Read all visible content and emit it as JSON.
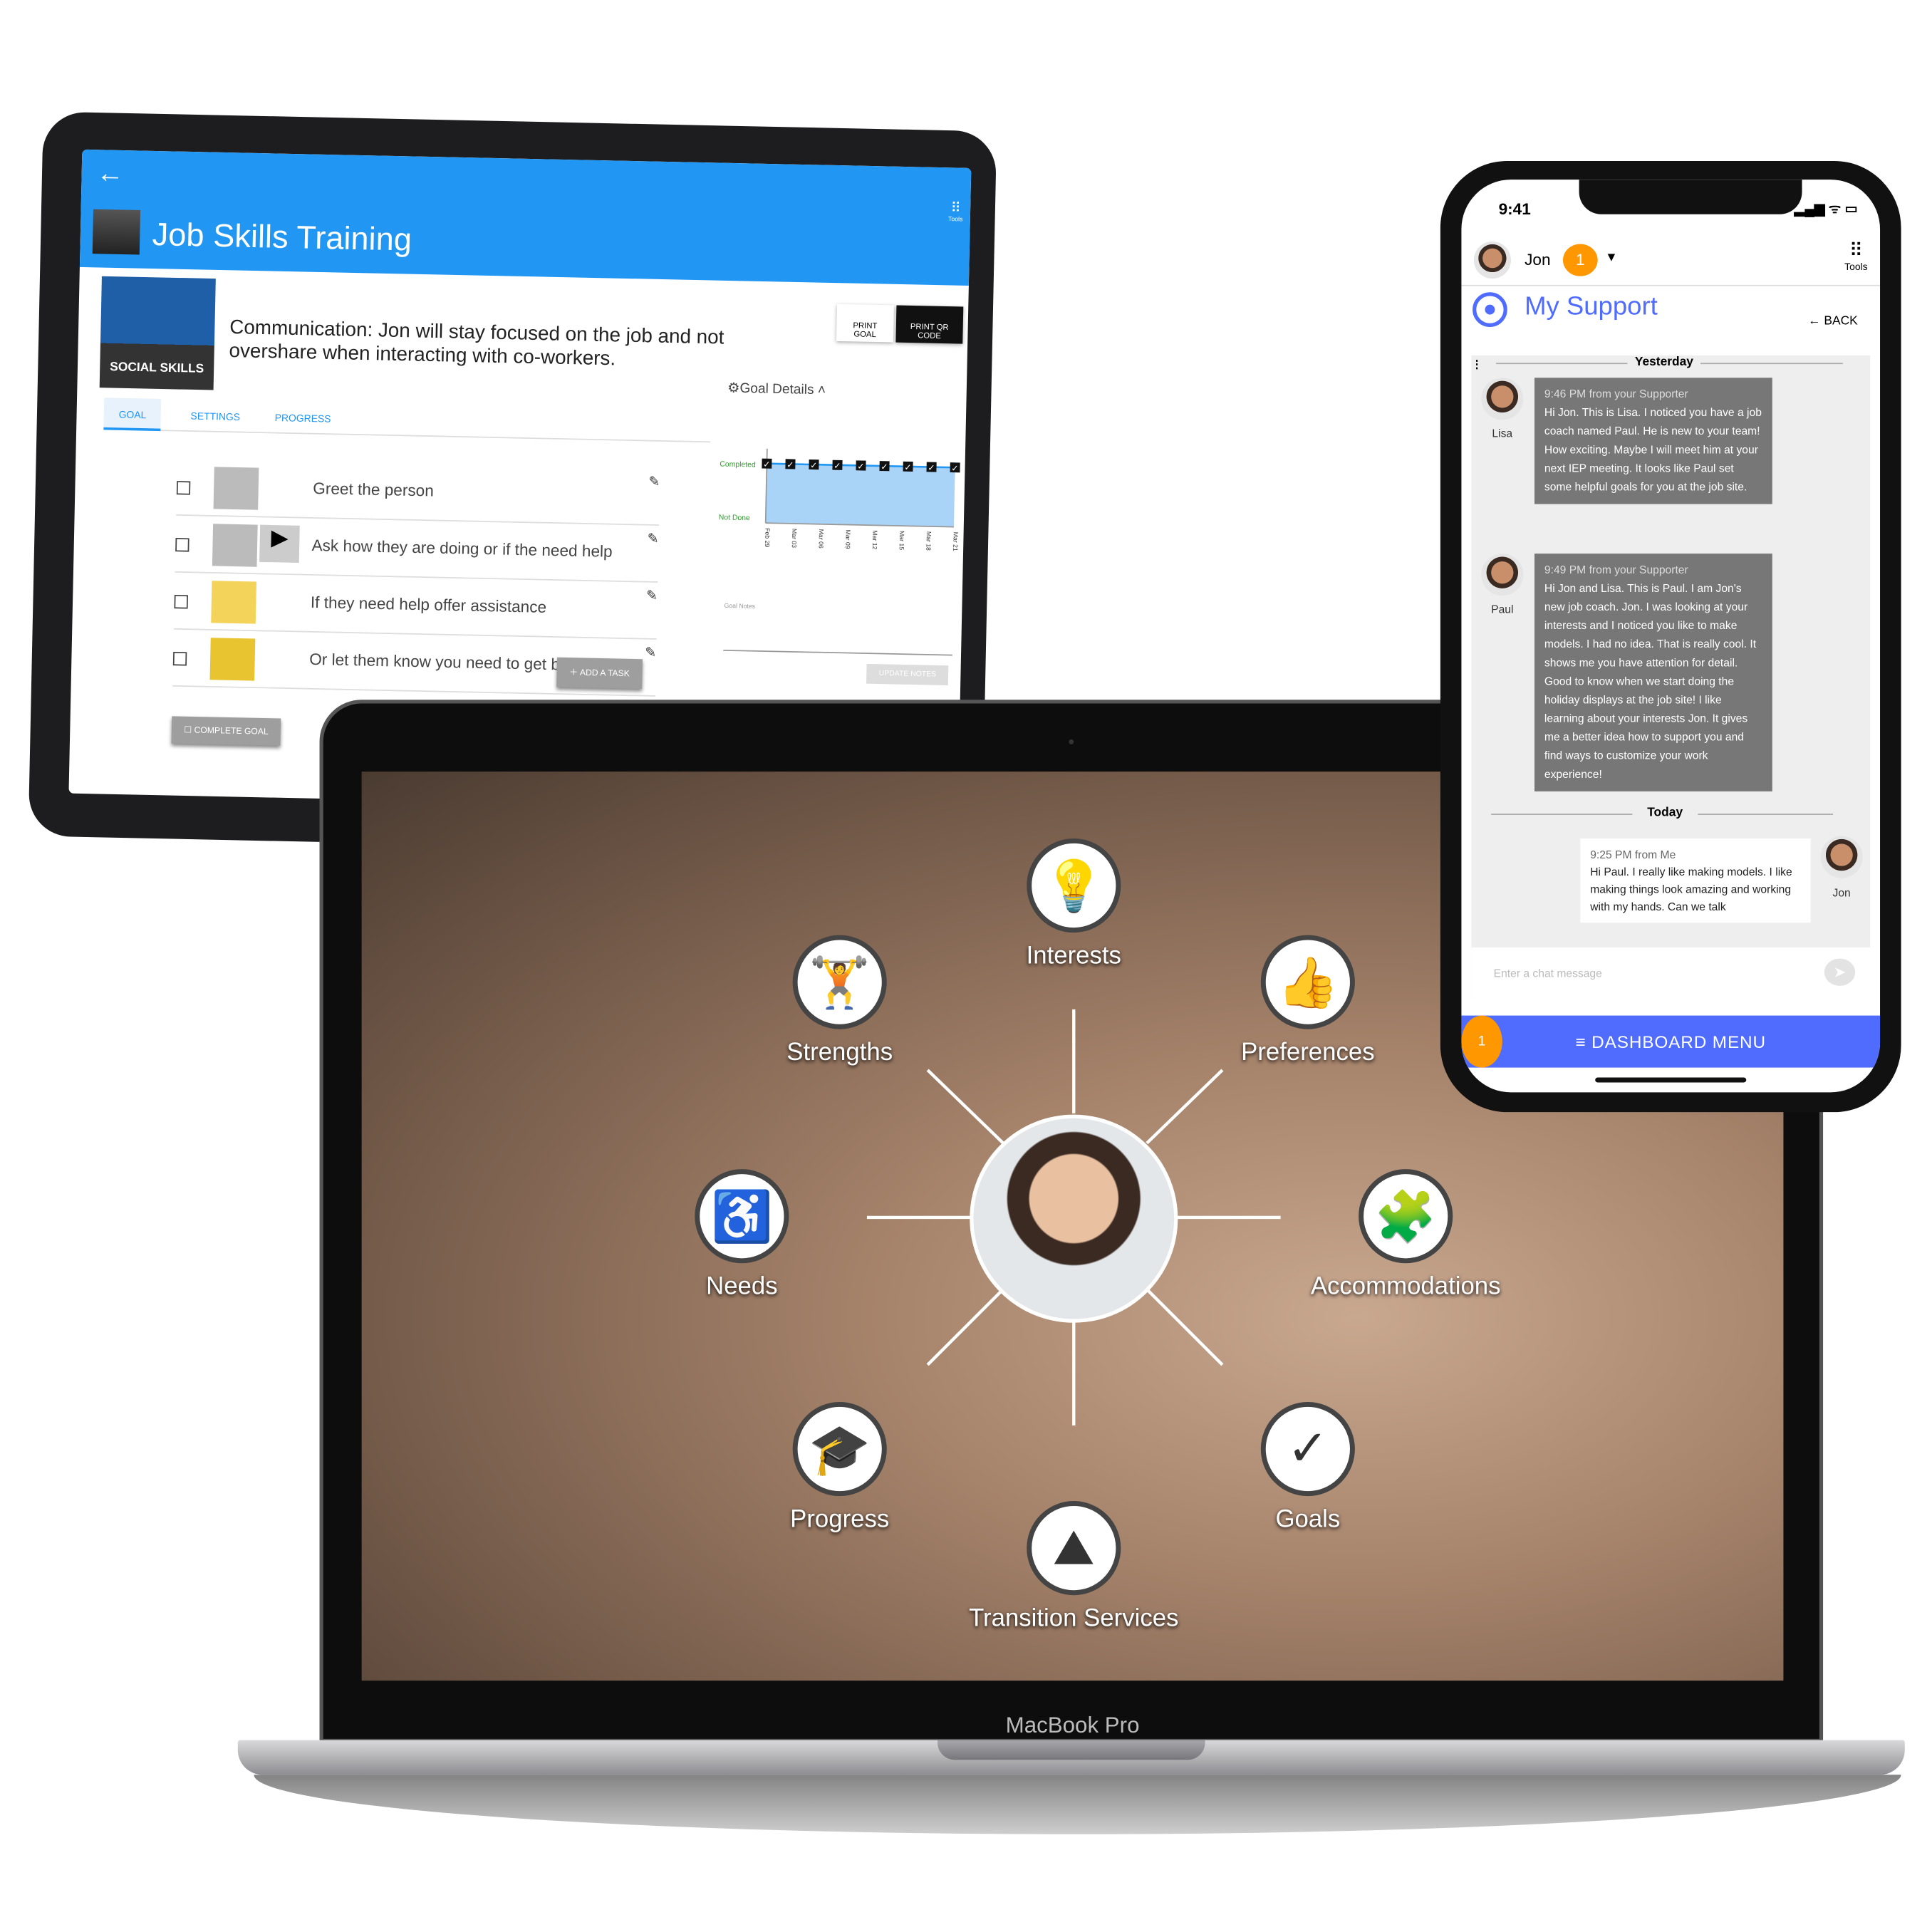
{
  "tablet": {
    "back_icon": "arrow-left-icon",
    "tools_label": "Tools",
    "title": "Job Skills Training",
    "category_badge": "SOCIAL SKILLS",
    "goal_text": "Communication: Jon will stay focused on the job and not overshare when interacting with co-workers.",
    "print_goal": "PRINT GOAL",
    "print_qr": "PRINT QR CODE",
    "tabs": [
      {
        "label": "GOAL",
        "active": true
      },
      {
        "label": "SETTINGS"
      },
      {
        "label": "PROGRESS"
      }
    ],
    "tasks": [
      {
        "label": "Greet the person"
      },
      {
        "label": "Ask how they are doing or if the need help"
      },
      {
        "label": "If they need help offer assistance"
      },
      {
        "label": "Or let them know you need to get back to work"
      }
    ],
    "add_task": "ADD A TASK",
    "complete_goal": "COMPLETE GOAL",
    "goal_details": "Goal Details",
    "chart_data": {
      "type": "line",
      "categories": [
        "Feb 29",
        "Mar 03",
        "Mar 06",
        "Mar 09",
        "Mar 12",
        "Mar 15",
        "Mar 18",
        "Mar 21"
      ],
      "y_labels": [
        "Completed",
        "Not Done"
      ],
      "points": [
        "Completed",
        "Completed",
        "Completed",
        "Completed",
        "Completed",
        "Completed",
        "Completed",
        "Completed",
        "Completed"
      ]
    },
    "goal_notes": "Goal Notes",
    "update_notes": "UPDATE NOTES"
  },
  "laptop": {
    "brand": "MacBook Pro",
    "nodes": [
      {
        "label": "Interests",
        "icon": "lightbulb-icon",
        "glyph": "💡"
      },
      {
        "label": "Strengths",
        "icon": "dumbbell-icon",
        "glyph": "🏋"
      },
      {
        "label": "Preferences",
        "icon": "thumbs-up-icon",
        "glyph": "👍"
      },
      {
        "label": "Needs",
        "icon": "accessibility-icon",
        "glyph": "♿"
      },
      {
        "label": "Accommodations",
        "icon": "puzzle-icon",
        "glyph": "🧩"
      },
      {
        "label": "Progress",
        "icon": "graduation-cap-icon",
        "glyph": "🎓"
      },
      {
        "label": "Goals",
        "icon": "checkmark-icon",
        "glyph": "✓"
      },
      {
        "label": "Transition Services",
        "icon": "mountain-climber-icon",
        "glyph": "⛰"
      }
    ]
  },
  "phone": {
    "time": "9:41",
    "user": "Jon",
    "notification_count": "1",
    "tools_label": "Tools",
    "title": "My Support",
    "back": "BACK",
    "day_yesterday": "Yesterday",
    "day_today": "Today",
    "messages": [
      {
        "sender": "Lisa",
        "time": "9:46 PM",
        "from": "from your Supporter",
        "text": "Hi Jon. This is Lisa. I noticed you have a job coach named Paul. He is new to your team! How exciting.  Maybe I will meet him at your next IEP meeting. It looks like Paul set some helpful goals for you at the job site."
      },
      {
        "sender": "Paul",
        "time": "9:49 PM",
        "from": "from your Supporter",
        "text": "Hi Jon and Lisa. This is Paul. I am Jon's new job coach. Jon. I was looking at your interests and I noticed you like to make models. I had no idea. That is really cool. It shows me you have attention for detail. Good to know when we start doing the holiday displays at the job site! I like learning about your interests Jon. It gives me a better idea how to support you and find ways to customize your work experience!"
      },
      {
        "sender": "Jon",
        "time": "9:25 PM",
        "from": "from Me",
        "text": "Hi Paul. I really like making models. I like making things look amazing and working with my hands. Can we talk"
      }
    ],
    "input_placeholder": "Enter a chat message",
    "dashboard_menu": "≡  DASHBOARD MENU",
    "menu_badge": "1",
    "colors": {
      "accent": "#4f6cff",
      "badge": "#ff9800",
      "bubble": "#777777"
    }
  }
}
